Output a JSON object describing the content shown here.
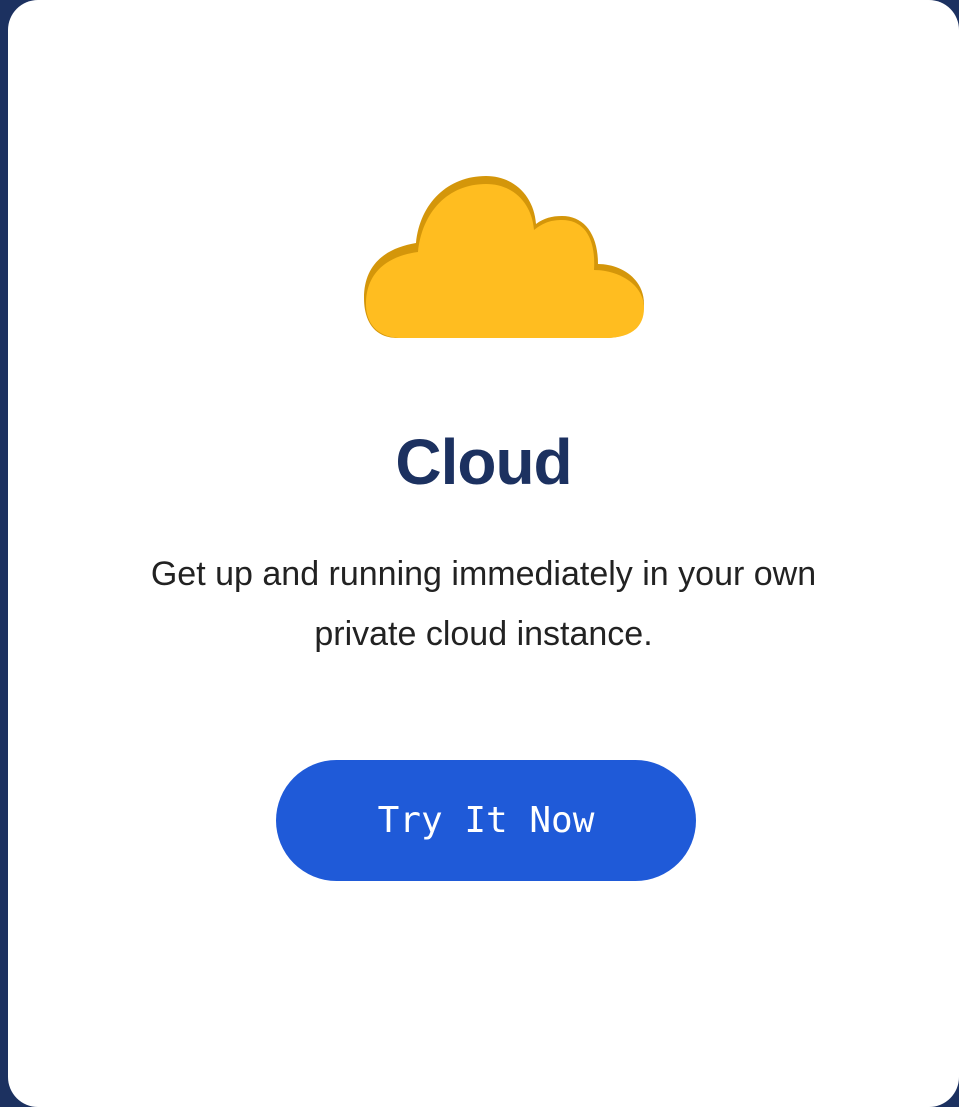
{
  "card": {
    "icon": "cloud-icon",
    "title": "Cloud",
    "description": "Get up and running immediately in your own private cloud instance.",
    "cta_label": "Try It Now"
  },
  "colors": {
    "background": "#1c3160",
    "card": "#ffffff",
    "title": "#1c3160",
    "cloud_fill": "#ffbd20",
    "cloud_edge": "#d4960a",
    "button": "#1f5ad8",
    "button_text": "#ffffff"
  }
}
